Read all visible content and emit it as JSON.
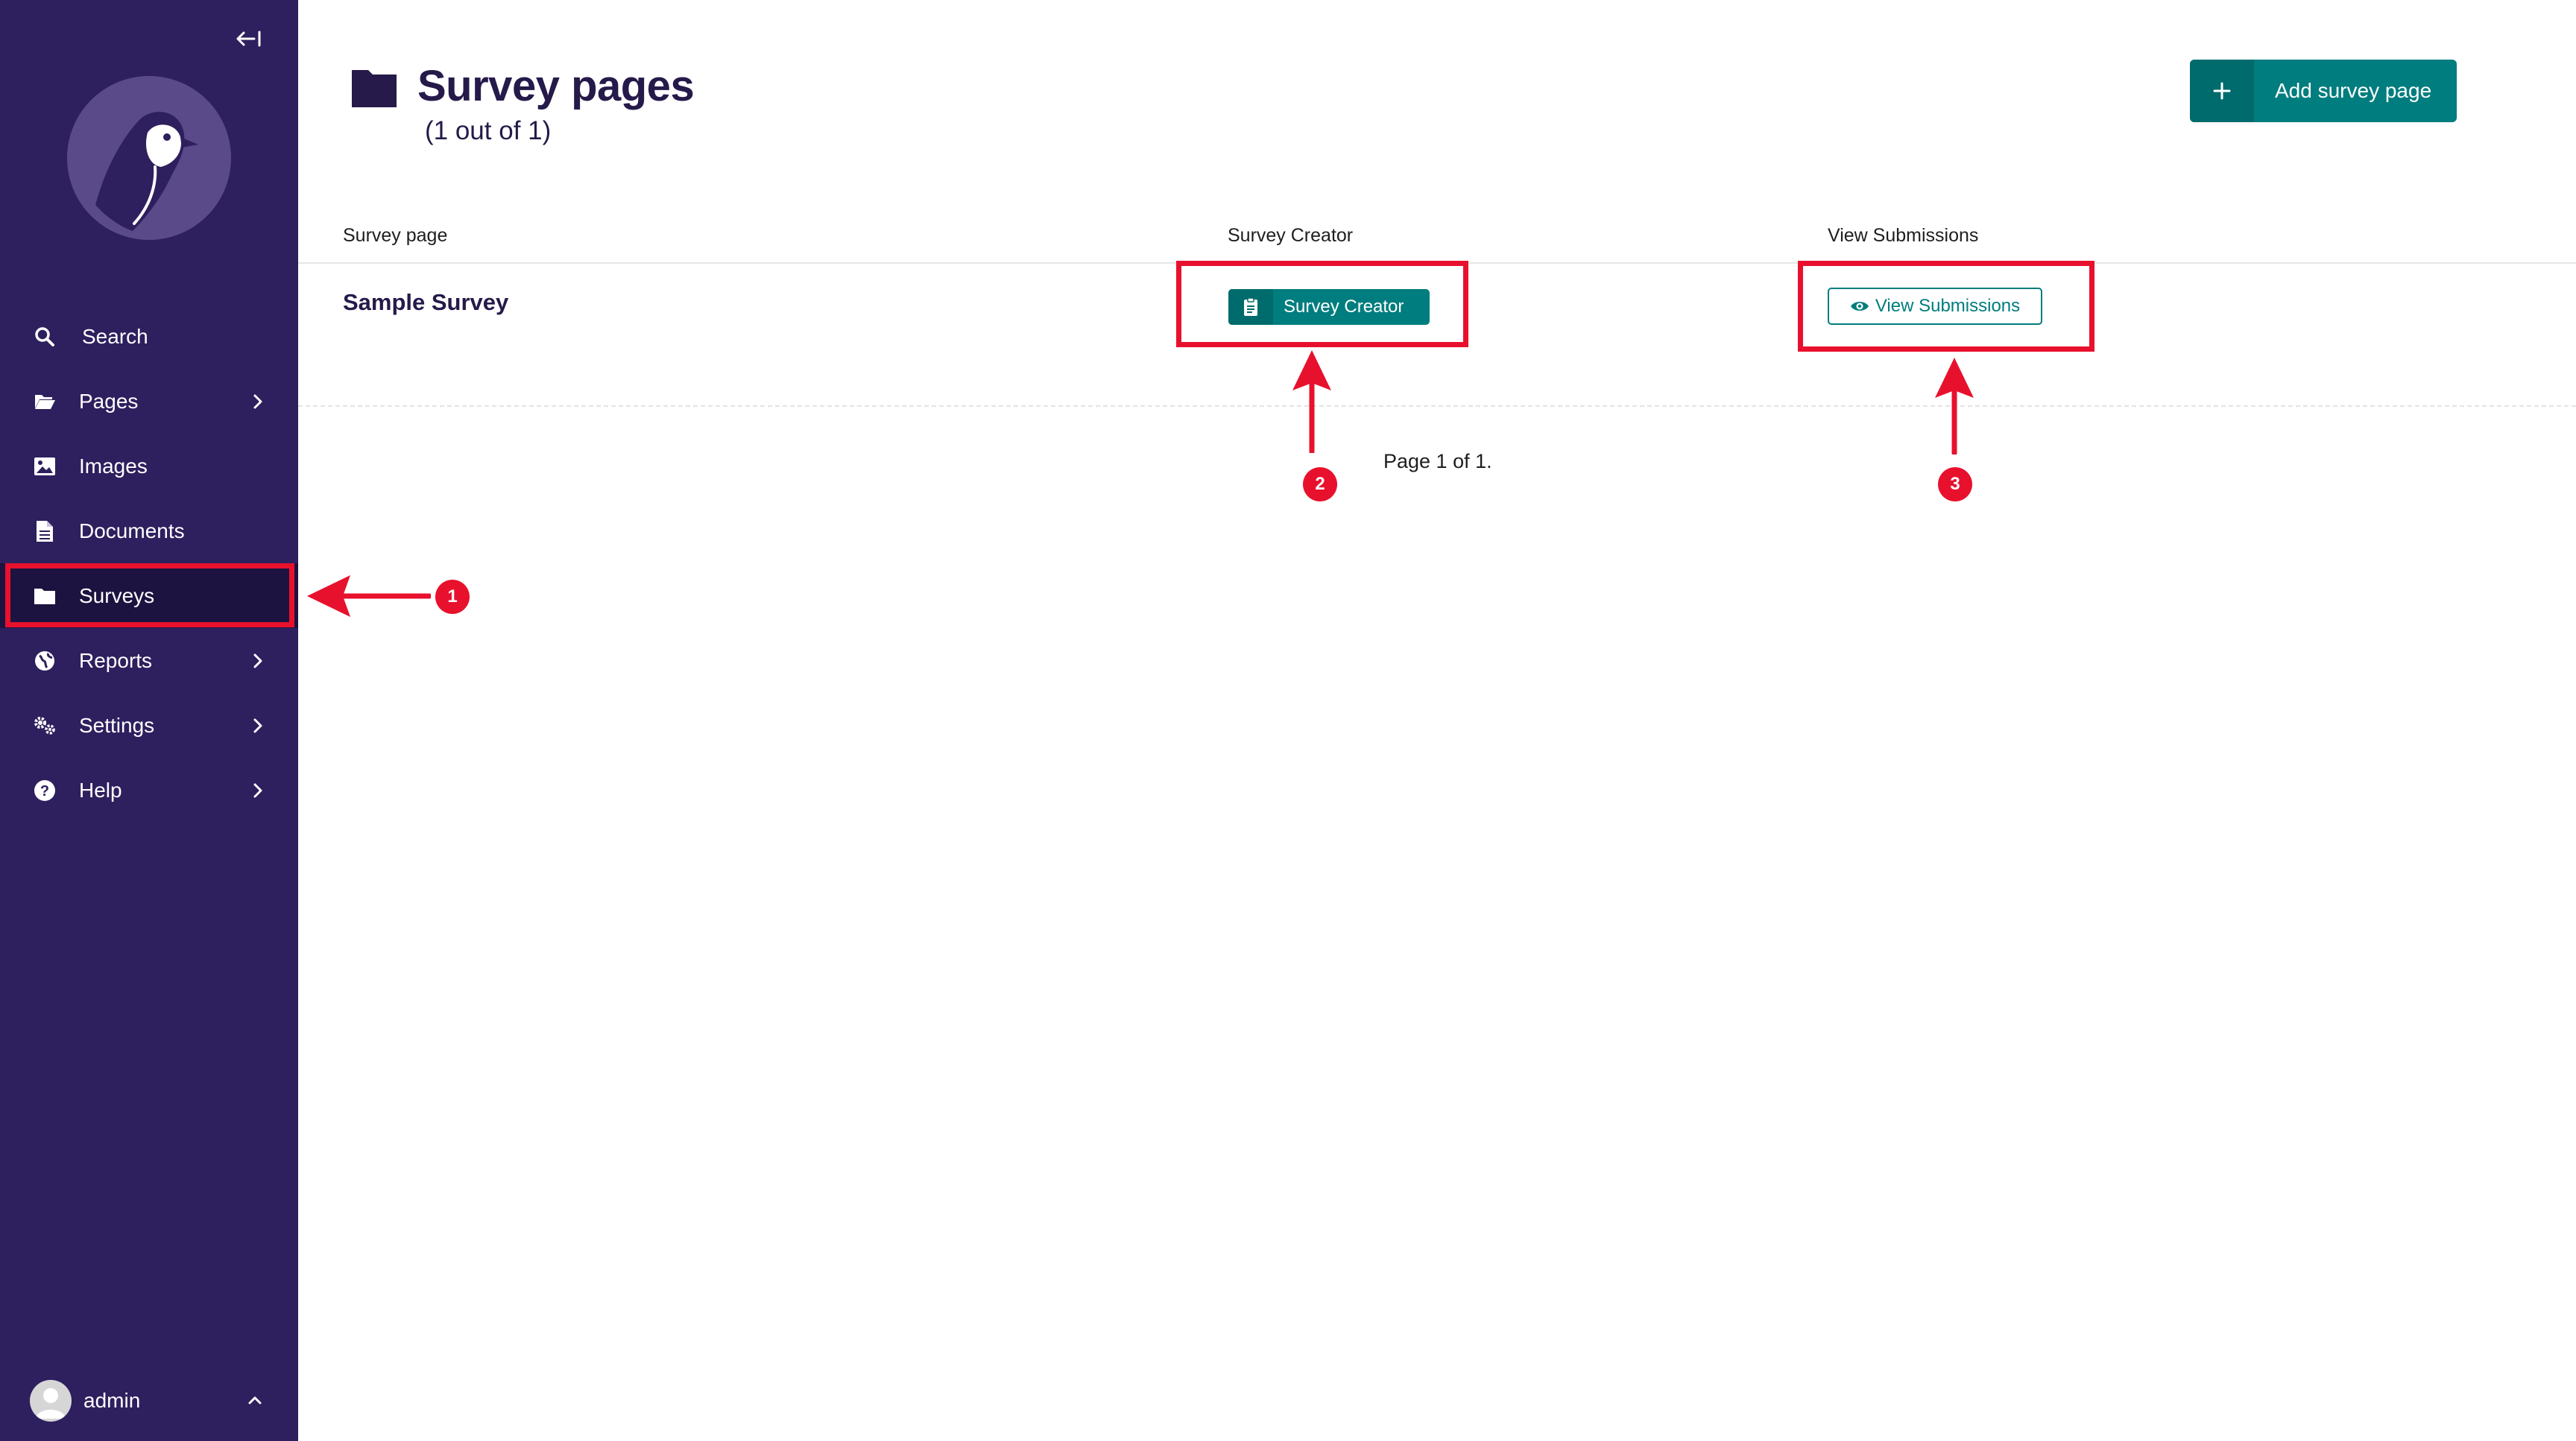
{
  "sidebar": {
    "collapse_icon": "collapse-left-icon",
    "logo": "wagtail-bird-logo",
    "items": [
      {
        "label": "Search",
        "icon": "search-icon",
        "has_submenu": false
      },
      {
        "label": "Pages",
        "icon": "folder-open-icon",
        "has_submenu": true
      },
      {
        "label": "Images",
        "icon": "image-icon",
        "has_submenu": false
      },
      {
        "label": "Documents",
        "icon": "document-icon",
        "has_submenu": false
      },
      {
        "label": "Surveys",
        "icon": "folder-icon",
        "has_submenu": false,
        "active": true
      },
      {
        "label": "Reports",
        "icon": "globe-icon",
        "has_submenu": true
      },
      {
        "label": "Settings",
        "icon": "cogs-icon",
        "has_submenu": true
      },
      {
        "label": "Help",
        "icon": "help-icon",
        "has_submenu": true
      }
    ],
    "user": {
      "name": "admin",
      "icon": "avatar-icon",
      "caret_icon": "chevron-up-icon"
    }
  },
  "header": {
    "icon": "folder-icon",
    "title": "Survey pages",
    "subtitle": "(1 out of 1)",
    "add_button_label": "Add survey page",
    "add_button_icon": "plus-icon"
  },
  "table": {
    "columns": [
      "Survey page",
      "Survey Creator",
      "View Submissions"
    ],
    "rows": [
      {
        "title": "Sample Survey",
        "creator_button": "Survey Creator",
        "creator_icon": "clipboard-icon",
        "submissions_button": "View Submissions",
        "submissions_icon": "eye-icon"
      }
    ]
  },
  "pagination": {
    "text": "Page 1 of 1."
  },
  "annotations": {
    "badges": [
      "1",
      "2",
      "3"
    ],
    "color": "#e8112d"
  },
  "colors": {
    "sidebar_bg": "#2e1f5e",
    "sidebar_active": "#1c1340",
    "accent_teal": "#007d7e",
    "title_text": "#261a4a",
    "annotation_red": "#e8112d"
  }
}
